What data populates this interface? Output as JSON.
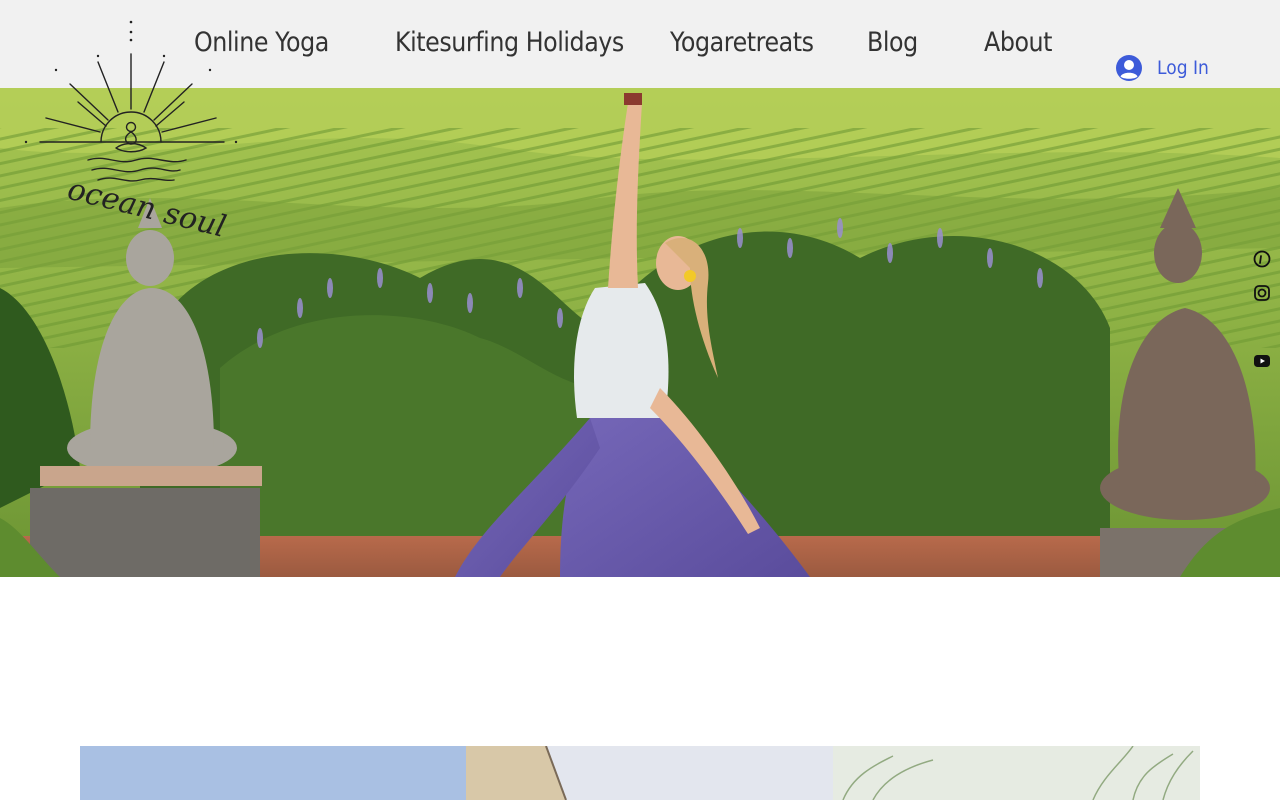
{
  "brand": {
    "logo_text": "ocean soul",
    "logo_icon": "sunrise-meditation-icon"
  },
  "nav": {
    "items": [
      {
        "label": "Online Yoga"
      },
      {
        "label": "Kitesurfing Holidays"
      },
      {
        "label": "Yogaretreats"
      },
      {
        "label": "Blog"
      },
      {
        "label": "About"
      }
    ]
  },
  "login": {
    "label": "Log In",
    "icon": "user-avatar-icon"
  },
  "social": {
    "icons": [
      "pinterest-icon",
      "instagram-icon",
      "youtube-icon"
    ]
  },
  "hero": {
    "image": "yoga-pose-lavender-field-photo"
  },
  "gallery": {
    "tiles": [
      "sky-photo",
      "building-photo",
      "reeds-photo"
    ]
  },
  "colors": {
    "header_bg": "#f1f1f1",
    "nav_text": "#333333",
    "accent": "#3d5bd9"
  }
}
